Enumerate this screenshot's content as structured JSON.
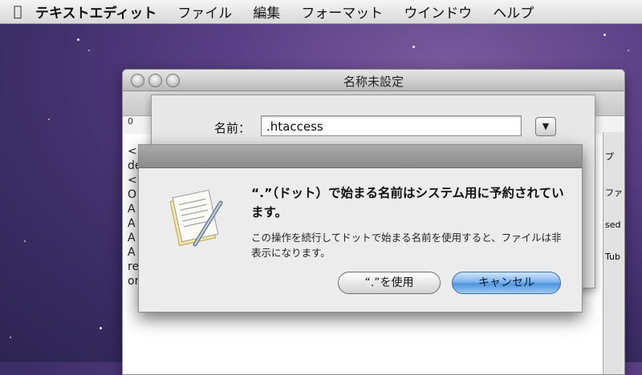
{
  "menubar": {
    "app_name": "テキストエディット",
    "items": [
      "ファイル",
      "編集",
      "フォーマット",
      "ウインドウ",
      "ヘルプ"
    ]
  },
  "back_window": {
    "title": "名称未設定",
    "ruler_zero": "0",
    "doc_lines": [
      "<",
      "de",
      "<",
      "O",
      "A",
      "A",
      "A",
      "A",
      "re",
      "or"
    ],
    "side_fragments": [
      "プ",
      "ファ",
      "sed",
      "Tub"
    ]
  },
  "save_sheet": {
    "name_label": "名前：",
    "filename": ".htaccess"
  },
  "alert": {
    "message": "“.”（ドット）で始まる名前はシステム用に予約されています。",
    "informative": "この操作を続行してドットで始まる名前を使用すると、ファイルは非表示になります。",
    "use_button": "“.”を使用",
    "cancel_button": "キャンセル"
  },
  "colors": {
    "default_button": "#5e9fe4",
    "desktop": "#4a3578"
  },
  "icons": [
    "apple-icon",
    "textedit-document-icon",
    "chevron-down-icon"
  ]
}
